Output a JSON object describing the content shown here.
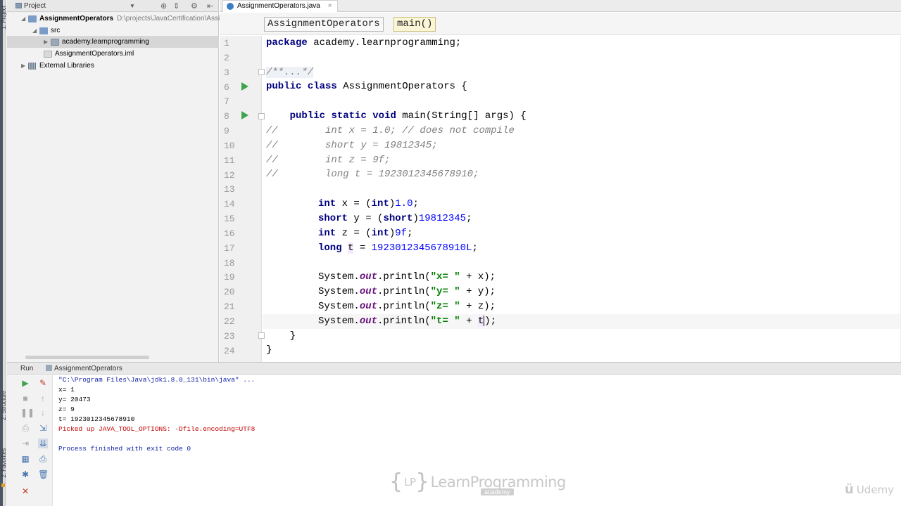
{
  "tool_stripe": {
    "project_label": "1: Project",
    "structure_label": "Z: Structure",
    "favorites_label": "2: Favorites"
  },
  "project_panel": {
    "title": "Project",
    "tree": [
      {
        "label": "AssignmentOperators",
        "path": "D:\\projects\\JavaCertification\\Assi",
        "icon": "folder-icon"
      },
      {
        "label": "src",
        "icon": "folder-icon"
      },
      {
        "label": "academy.learnprogramming",
        "icon": "package-icon"
      },
      {
        "label": "AssignmentOperators.iml",
        "icon": "iml-file-icon"
      },
      {
        "label": "External Libraries",
        "icon": "library-icon"
      }
    ]
  },
  "editor": {
    "tab_label": "AssignmentOperators.java",
    "tab_close": "×",
    "breadcrumb": [
      "AssignmentOperators",
      "main()"
    ],
    "line_numbers": [
      "1",
      "2",
      "3",
      "6",
      "7",
      "8",
      "9",
      "10",
      "11",
      "12",
      "13",
      "14",
      "15",
      "16",
      "17",
      "18",
      "19",
      "20",
      "21",
      "22",
      "23",
      "24"
    ],
    "code": {
      "l1_kw": "package",
      "l1_rest": " academy.learnprogramming;",
      "l3_fold": "/**...*/",
      "l6_kw1": "public",
      "l6_kw2": "class",
      "l6_rest": " AssignmentOperators {",
      "l8_indent": "    ",
      "l8_kw1": "public",
      "l8_kw2": "static",
      "l8_kw3": "void",
      "l8_rest": " main(String[] args) {",
      "l9": "//        int x = 1.0; // does not compile",
      "l10": "//        short y = 19812345;",
      "l11": "//        int z = 9f;",
      "l12": "//        long t = 1923012345678910;",
      "l14_kw1": "int",
      "l14_mid": " x = (",
      "l14_kw2": "int",
      "l14_close": ")",
      "l14_num": "1.0",
      "l14_end": ";",
      "l15_kw1": "short",
      "l15_mid": " y = (",
      "l15_kw2": "short",
      "l15_close": ")",
      "l15_num": "19812345",
      "l15_end": ";",
      "l16_kw1": "int",
      "l16_mid": " z = (",
      "l16_kw2": "int",
      "l16_close": ")",
      "l16_num": "9f",
      "l16_end": ";",
      "l17_kw1": "long",
      "l17_sp": " ",
      "l17_var": "t",
      "l17_mid": " = ",
      "l17_num": "1923012345678910L",
      "l17_end": ";",
      "sys": "System.",
      "out": "out",
      "println": ".println(",
      "s19": "\"x= \"",
      "e19": " + x);",
      "s20": "\"y= \"",
      "e20": " + y);",
      "s21": "\"z= \"",
      "e21": " + z);",
      "s22": "\"t= \"",
      "e22a": " + ",
      "e22b": "t",
      "e22c": ");",
      "l23": "    }",
      "l24": "}"
    }
  },
  "run_panel": {
    "tab_label": "Run",
    "config_label": "AssignmentOperators",
    "console": [
      {
        "text": "\"C:\\Program Files\\Java\\jdk1.8.0_131\\bin\\java\" ...",
        "kind": "cmd"
      },
      {
        "text": "x= 1",
        "kind": "out"
      },
      {
        "text": "y= 20473",
        "kind": "out"
      },
      {
        "text": "z= 9",
        "kind": "out"
      },
      {
        "text": "t= 1923012345678910",
        "kind": "out"
      },
      {
        "text": "Picked up JAVA_TOOL_OPTIONS: -Dfile.encoding=UTF8",
        "kind": "err"
      },
      {
        "text": "",
        "kind": "out"
      },
      {
        "text": "Process finished with exit code 0",
        "kind": "exit"
      }
    ]
  },
  "watermark": {
    "lp_left": "{",
    "lp_mark": "LP",
    "lp_right": "}",
    "lp_text": "LearnProgramming",
    "lp_academy": "academy",
    "udemy": "Udemy"
  },
  "colors": {
    "keyword": "#000080",
    "comment": "#808080",
    "number": "#0000ff",
    "string": "#008000",
    "field": "#660e7a",
    "run_arrow": "#3fa34d",
    "console_error": "#c00000"
  }
}
